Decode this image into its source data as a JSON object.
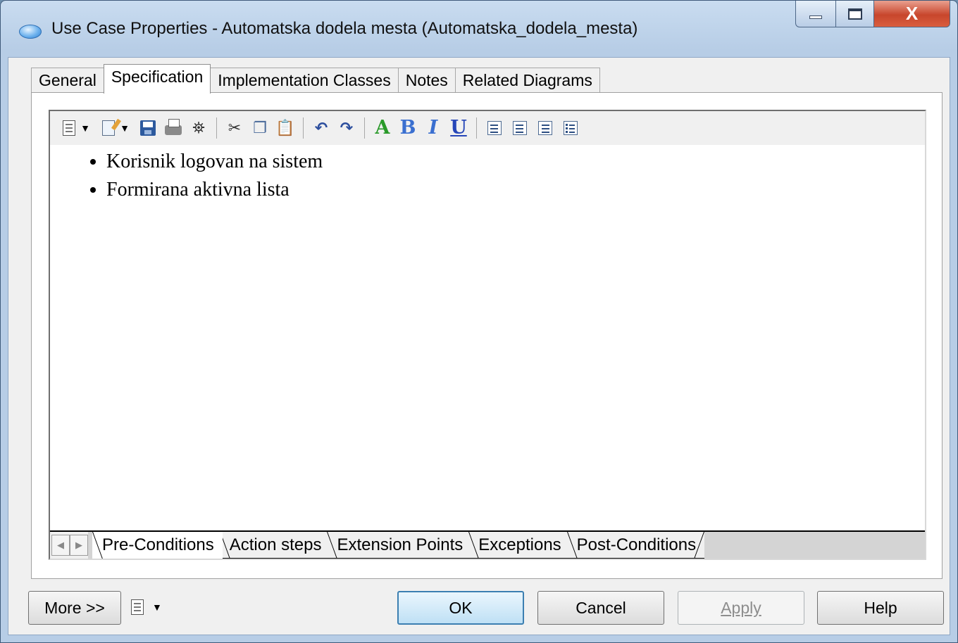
{
  "window": {
    "title": "Use Case Properties - Automatska dodela mesta (Automatska_dodela_mesta)",
    "icon": "use-case-ellipse-icon"
  },
  "caption": {
    "minimize": "minimize-icon",
    "maximize": "maximize-icon",
    "close": "X"
  },
  "tabs": [
    {
      "label": "General"
    },
    {
      "label": "Specification",
      "active": true
    },
    {
      "label": "Implementation Classes"
    },
    {
      "label": "Notes"
    },
    {
      "label": "Related Diagrams"
    }
  ],
  "toolbar": {
    "icons": [
      "document-menu-icon",
      "edit-menu-icon",
      "save-icon",
      "print-icon",
      "find-icon",
      "cut-icon",
      "copy-icon",
      "paste-icon",
      "undo-icon",
      "redo-icon",
      "font-color-icon",
      "bold-icon",
      "italic-icon",
      "underline-icon",
      "align-left-icon",
      "align-center-icon",
      "align-right-icon",
      "bullet-list-icon"
    ],
    "font_color_label": "A",
    "bold_label": "B",
    "italic_label": "I",
    "underline_label": "U"
  },
  "editor": {
    "bullets": [
      "Korisnik logovan na sistem",
      "Formirana aktivna lista"
    ]
  },
  "sheet_tabs": [
    {
      "label": "Pre-Conditions",
      "active": true
    },
    {
      "label": "Action steps"
    },
    {
      "label": "Extension Points"
    },
    {
      "label": "Exceptions"
    },
    {
      "label": "Post-Conditions"
    }
  ],
  "buttons": {
    "more": "More >>",
    "ok": "OK",
    "cancel": "Cancel",
    "apply": "Apply",
    "help": "Help"
  },
  "colors": {
    "default_button_border": "#3c7fb1",
    "close_button": "#c8462c",
    "font_color_icon": "#2a9a2a",
    "format_icon": "#3a6fd0"
  }
}
